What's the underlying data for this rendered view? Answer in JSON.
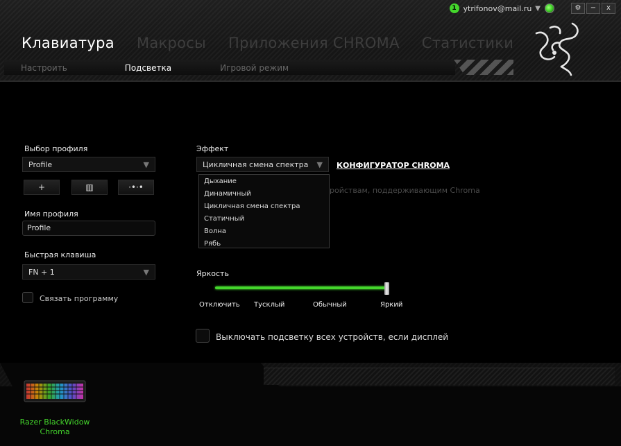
{
  "user": {
    "notification_count": "1",
    "email": "ytrifonov@mail.ru"
  },
  "window_controls": {
    "settings": "⚙",
    "minimize": "−",
    "close": "x"
  },
  "nav": {
    "tabs": [
      "Клавиатура",
      "Макросы",
      "Приложения CHROMA",
      "Статистики"
    ],
    "active_index": 0
  },
  "subnav": {
    "tabs": [
      "Настроить",
      "Подсветка",
      "Игровой режим"
    ],
    "active_index": 1
  },
  "profile": {
    "select_label": "Выбор профиля",
    "selected": "Profile",
    "buttons": [
      "+",
      "▥",
      "·•·•"
    ],
    "name_label": "Имя профиля",
    "name_value": "Profile",
    "hotkey_label": "Быстрая клавиша",
    "hotkey_value": "FN + 1",
    "link_program_label": "Связать программу",
    "link_program_checked": false
  },
  "effect": {
    "label": "Эффект",
    "selected": "Цикличная смена спектра",
    "options": [
      "Дыхание",
      "Динамичный",
      "Цикличная смена спектра",
      "Статичный",
      "Волна",
      "Рябь"
    ],
    "config_link": "КОНФИГУРАТОР CHROMA",
    "hint_text": "ройствам, поддерживающим Chroma"
  },
  "brightness": {
    "label": "Яркость",
    "value_fraction": 1.0,
    "ticks": [
      "Отключить",
      "Тусклый",
      "Обычный",
      "Яркий"
    ]
  },
  "display_off": {
    "label": "Выключать подсветку всех устройств, если дисплей",
    "checked": false
  },
  "device": {
    "name_line1": "Razer BlackWidow",
    "name_line2": "Chroma"
  },
  "colors": {
    "accent": "#44d62c",
    "background": "#000000",
    "inactive_tab": "#3d3d3d"
  },
  "icons": {
    "settings": "gear-icon",
    "minimize": "minimize-icon",
    "close": "close-icon",
    "dropdown": "chevron-down-icon",
    "logo": "razer-logo"
  }
}
